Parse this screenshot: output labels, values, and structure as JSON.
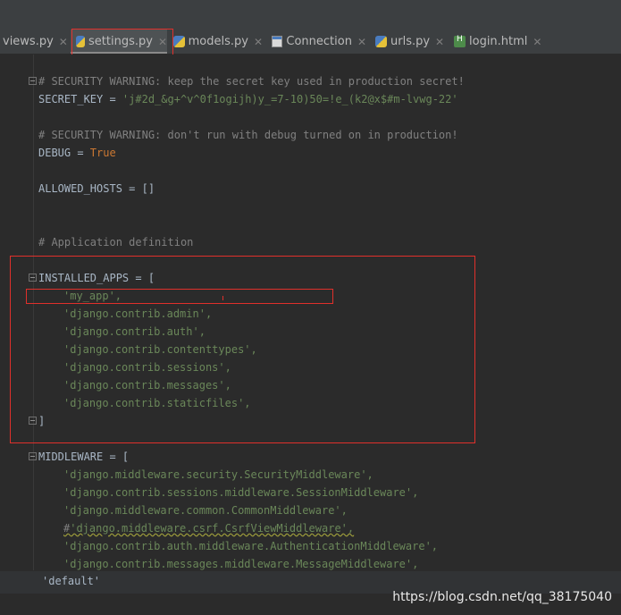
{
  "tabs": [
    {
      "label": "views.py"
    },
    {
      "label": "settings.py"
    },
    {
      "label": "models.py"
    },
    {
      "label": "Connection"
    },
    {
      "label": "urls.py"
    },
    {
      "label": "login.html"
    }
  ],
  "code": {
    "c1": "# SECURITY WARNING: keep the secret key used in production secret!",
    "secret_name": "SECRET_KEY = ",
    "secret_value": "'j#2d_&g+^v^0f1ogijh)y_=7-10)50=!e_(k2@x$#m-lvwg-22'",
    "c2": "# SECURITY WARNING: don't run with debug turned on in production!",
    "debug_name": "DEBUG = ",
    "debug_value": "True",
    "allowed_hosts": "ALLOWED_HOSTS = []",
    "c3": "# Application definition",
    "installed_open": "INSTALLED_APPS = [",
    "apps": [
      "'my_app',",
      "'django.contrib.admin',",
      "'django.contrib.auth',",
      "'django.contrib.contenttypes',",
      "'django.contrib.sessions',",
      "'django.contrib.messages',",
      "'django.contrib.staticfiles',"
    ],
    "installed_close": "]",
    "middleware_open": "MIDDLEWARE = [",
    "m1": "'django.middleware.security.SecurityMiddleware',",
    "m2": "'django.contrib.sessions.middleware.SessionMiddleware',",
    "m3": "'django.middleware.common.CommonMiddleware',",
    "m4_comment": "#",
    "m4_value": "'django.middleware.csrf.CsrfViewMiddleware',",
    "m5": "'django.contrib.auth.middleware.AuthenticationMiddleware',",
    "m6": "'django.contrib.messages.middleware.MessageMiddleware',"
  },
  "status": {
    "text": "'default'"
  },
  "watermark": "https://blog.csdn.net/qq_38175040",
  "colors": {
    "comment": "#808080",
    "string": "#6a8759",
    "keyword": "#cc7832",
    "highlight": "#e0302b"
  }
}
